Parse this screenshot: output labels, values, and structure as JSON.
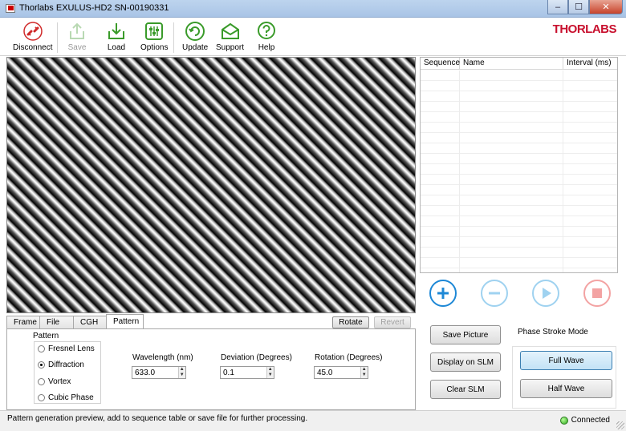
{
  "window": {
    "title": "Thorlabs EXULUS-HD2 SN-00190331",
    "minimize": "–",
    "maximize": "☐",
    "close": "✕"
  },
  "toolbar": {
    "items": [
      {
        "label": "Disconnect",
        "icon": "disconnect-icon",
        "enabled": true
      },
      {
        "label": "Save",
        "icon": "save-icon",
        "enabled": false
      },
      {
        "label": "Load",
        "icon": "load-icon",
        "enabled": true
      },
      {
        "label": "Options",
        "icon": "options-icon",
        "enabled": true
      },
      {
        "label": "Update",
        "icon": "update-icon",
        "enabled": true
      },
      {
        "label": "Support",
        "icon": "support-icon",
        "enabled": true
      },
      {
        "label": "Help",
        "icon": "help-icon",
        "enabled": true
      }
    ],
    "brand_bold": "THOR",
    "brand_thin": "LABS"
  },
  "sequence_table": {
    "columns": [
      "Sequence",
      "Name",
      "Interval (ms)"
    ],
    "rows": []
  },
  "sequence_buttons": {
    "add": "plus-icon",
    "remove": "minus-icon",
    "play": "play-icon",
    "stop": "stop-icon"
  },
  "tabs": [
    "Frame",
    "File",
    "CGH",
    "Pattern"
  ],
  "active_tab": "Pattern",
  "tab_actions": {
    "rotate": "Rotate",
    "revert": "Revert"
  },
  "pattern": {
    "group_title": "Pattern",
    "options": [
      "Fresnel Lens",
      "Diffraction",
      "Vortex",
      "Cubic Phase"
    ],
    "selected": "Diffraction",
    "wavelength_label": "Wavelength (nm)",
    "wavelength_value": "633.0",
    "deviation_label": "Deviation (Degrees)",
    "deviation_value": "0.1",
    "rotation_label": "Rotation (Degrees)",
    "rotation_value": "45.0"
  },
  "actions": {
    "save_picture": "Save Picture",
    "display_on_slm": "Display on SLM",
    "clear_slm": "Clear SLM"
  },
  "phase_stroke": {
    "title": "Phase Stroke Mode",
    "full_wave": "Full Wave",
    "half_wave": "Half Wave",
    "selected": "Full Wave"
  },
  "status": {
    "message": "Pattern generation preview, add to sequence table or save file for further processing.",
    "connection": "Connected",
    "connection_color": "#2aa71a"
  },
  "colors": {
    "accent_blue": "#1e88d6",
    "disabled_blue": "#9fd2f0",
    "stop_red": "#f3a3a3",
    "toolbar_green": "#3a9b2a",
    "brand_red": "#c8102e"
  }
}
